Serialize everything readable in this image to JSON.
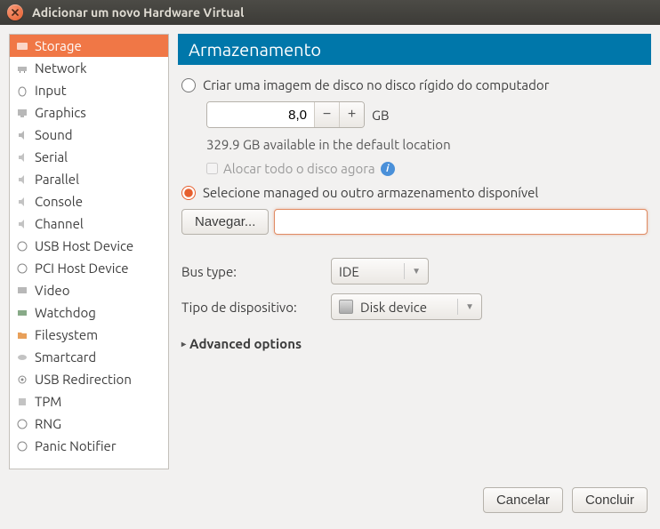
{
  "window": {
    "title": "Adicionar um novo Hardware Virtual"
  },
  "sidebar": {
    "items": [
      {
        "label": "Storage",
        "icon": "storage",
        "selected": true
      },
      {
        "label": "Network",
        "icon": "network"
      },
      {
        "label": "Input",
        "icon": "input"
      },
      {
        "label": "Graphics",
        "icon": "graphics"
      },
      {
        "label": "Sound",
        "icon": "sound"
      },
      {
        "label": "Serial",
        "icon": "serial"
      },
      {
        "label": "Parallel",
        "icon": "parallel"
      },
      {
        "label": "Console",
        "icon": "console"
      },
      {
        "label": "Channel",
        "icon": "channel"
      },
      {
        "label": "USB Host Device",
        "icon": "usb"
      },
      {
        "label": "PCI Host Device",
        "icon": "pci"
      },
      {
        "label": "Video",
        "icon": "video"
      },
      {
        "label": "Watchdog",
        "icon": "watchdog"
      },
      {
        "label": "Filesystem",
        "icon": "filesystem"
      },
      {
        "label": "Smartcard",
        "icon": "smartcard"
      },
      {
        "label": "USB Redirection",
        "icon": "usbredir"
      },
      {
        "label": "TPM",
        "icon": "tpm"
      },
      {
        "label": "RNG",
        "icon": "rng"
      },
      {
        "label": "Panic Notifier",
        "icon": "panic"
      }
    ]
  },
  "main": {
    "header": "Armazenamento",
    "radio_create": "Criar uma imagem de disco no disco rígido do computador",
    "size_value": "8,0",
    "size_unit": "GB",
    "available": "329.9 GB available in the default location",
    "allocate_label": "Alocar todo o disco agora",
    "radio_select": "Selecione managed ou outro armazenamento disponível",
    "browse_label": "Navegar...",
    "path_value": "",
    "bus_label": "Bus type:",
    "bus_value": "IDE",
    "devtype_label": "Tipo de dispositivo:",
    "devtype_value": "Disk device",
    "advanced": "Advanced options"
  },
  "footer": {
    "cancel": "Cancelar",
    "finish": "Concluir"
  }
}
